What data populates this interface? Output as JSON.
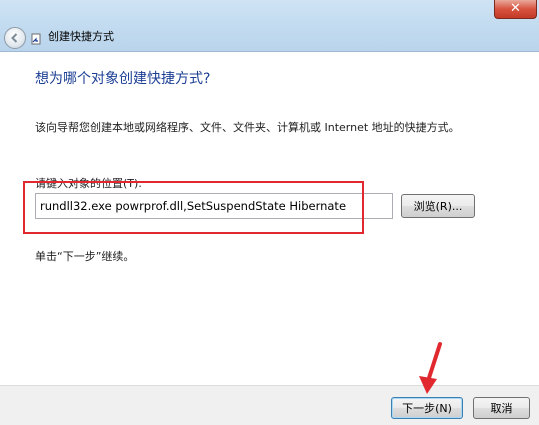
{
  "window": {
    "title": "创建快捷方式",
    "close_symbol": "✕"
  },
  "page": {
    "heading": "想为哪个对象创建快捷方式?",
    "description": "该向导帮您创建本地或网络程序、文件、文件夹、计算机或 Internet 地址的快捷方式。",
    "location_label": "请键入对象的位置(T):",
    "location_value": "rundll32.exe powrprof.dll,SetSuspendState Hibernate",
    "browse_label": "浏览(R)...",
    "hint": "单击“下一步”继续。"
  },
  "footer": {
    "next_label": "下一步(N)",
    "cancel_label": "取消"
  },
  "colors": {
    "heading": "#1c3f94",
    "highlight": "#e0282e",
    "close_button": "#d8533f"
  },
  "icons": [
    "close-icon",
    "back-arrow-icon",
    "shortcut-wizard-icon",
    "annotation-arrow"
  ]
}
